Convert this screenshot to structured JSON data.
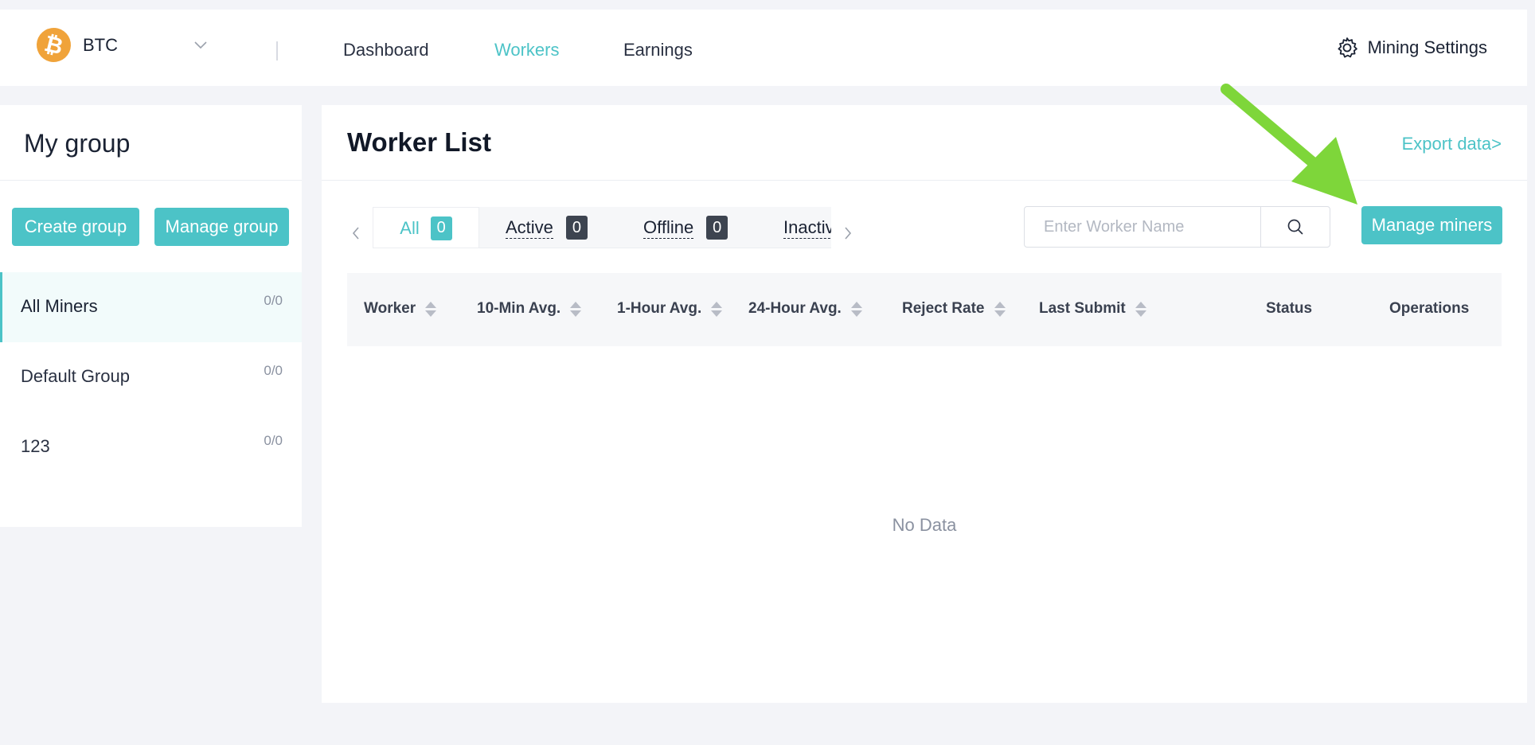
{
  "header": {
    "coin": {
      "symbol": "₿",
      "name": "BTC"
    },
    "nav": [
      "Dashboard",
      "Workers",
      "Earnings"
    ],
    "active_nav": "Workers",
    "settings_label": "Mining Settings"
  },
  "sidebar": {
    "title": "My group",
    "create_label": "Create group",
    "manage_label": "Manage group",
    "groups": [
      {
        "label": "All Miners",
        "count": "0/0"
      },
      {
        "label": "Default Group",
        "count": "0/0"
      },
      {
        "label": "123",
        "count": "0/0"
      }
    ]
  },
  "main": {
    "title": "Worker List",
    "export_label": "Export data>",
    "tabs": [
      {
        "label": "All",
        "count": "0"
      },
      {
        "label": "Active",
        "count": "0"
      },
      {
        "label": "Offline",
        "count": "0"
      },
      {
        "label": "Inactiv",
        "count": ""
      }
    ],
    "search": {
      "placeholder": "Enter Worker Name"
    },
    "manage_miners_label": "Manage miners",
    "columns": [
      "Worker",
      "10-Min Avg.",
      "1-Hour Avg.",
      "24-Hour Avg.",
      "Reject Rate",
      "Last Submit",
      "Status",
      "Operations"
    ],
    "empty_text": "No Data"
  },
  "colors": {
    "accent": "#4cc3c7",
    "annotation": "#7ed63a",
    "btc": "#f0a33a"
  }
}
